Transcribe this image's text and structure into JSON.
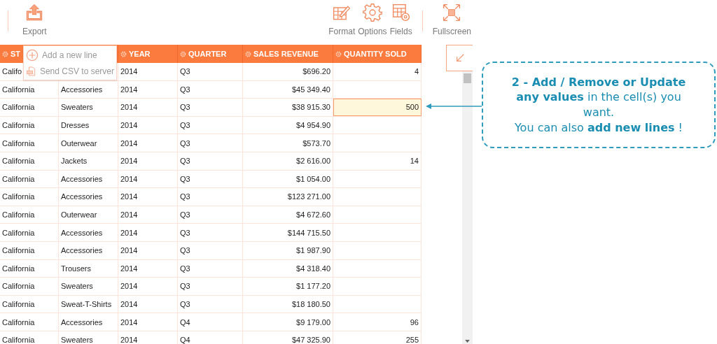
{
  "toolbar": {
    "left": [
      {
        "label": "Export"
      }
    ],
    "right": [
      {
        "label": "Format"
      },
      {
        "label": "Options"
      },
      {
        "label": "Fields"
      }
    ],
    "fullscreen": {
      "label": "Fullscreen"
    }
  },
  "export_menu": [
    {
      "label": "Add a new line"
    },
    {
      "label": "Send CSV to server"
    }
  ],
  "table": {
    "columns": [
      "ST",
      "YEAR",
      "QUARTER",
      "SALES REVENUE",
      "QUANTITY SOLD"
    ],
    "rows": [
      {
        "state": "Califo",
        "product": "",
        "year": "2014",
        "quarter": "Q3",
        "revenue": "$696.20",
        "quantity": "4",
        "editing": false
      },
      {
        "state": "California",
        "product": "Accessories",
        "year": "2014",
        "quarter": "Q3",
        "revenue": "$45 349.40",
        "quantity": "",
        "editing": false
      },
      {
        "state": "California",
        "product": "Sweaters",
        "year": "2014",
        "quarter": "Q3",
        "revenue": "$38 915.30",
        "quantity": "500",
        "editing": true
      },
      {
        "state": "California",
        "product": "Dresses",
        "year": "2014",
        "quarter": "Q3",
        "revenue": "$4 954.90",
        "quantity": "",
        "editing": false
      },
      {
        "state": "California",
        "product": "Outerwear",
        "year": "2014",
        "quarter": "Q3",
        "revenue": "$573.70",
        "quantity": "",
        "editing": false
      },
      {
        "state": "California",
        "product": "Jackets",
        "year": "2014",
        "quarter": "Q3",
        "revenue": "$2 616.00",
        "quantity": "14",
        "editing": false
      },
      {
        "state": "California",
        "product": "Accessories",
        "year": "2014",
        "quarter": "Q3",
        "revenue": "$1 054.00",
        "quantity": "",
        "editing": false
      },
      {
        "state": "California",
        "product": "Accessories",
        "year": "2014",
        "quarter": "Q3",
        "revenue": "$123 271.00",
        "quantity": "",
        "editing": false
      },
      {
        "state": "California",
        "product": "Outerwear",
        "year": "2014",
        "quarter": "Q3",
        "revenue": "$4 672.60",
        "quantity": "",
        "editing": false
      },
      {
        "state": "California",
        "product": "Accessories",
        "year": "2014",
        "quarter": "Q3",
        "revenue": "$144 715.50",
        "quantity": "",
        "editing": false
      },
      {
        "state": "California",
        "product": "Accessories",
        "year": "2014",
        "quarter": "Q3",
        "revenue": "$1 987.90",
        "quantity": "",
        "editing": false
      },
      {
        "state": "California",
        "product": "Trousers",
        "year": "2014",
        "quarter": "Q3",
        "revenue": "$4 318.40",
        "quantity": "",
        "editing": false
      },
      {
        "state": "California",
        "product": "Sweaters",
        "year": "2014",
        "quarter": "Q3",
        "revenue": "$1 177.20",
        "quantity": "",
        "editing": false
      },
      {
        "state": "California",
        "product": "Sweat-T-Shirts",
        "year": "2014",
        "quarter": "Q3",
        "revenue": "$18 180.50",
        "quantity": "",
        "editing": false
      },
      {
        "state": "California",
        "product": "Accessories",
        "year": "2014",
        "quarter": "Q4",
        "revenue": "$9 179.00",
        "quantity": "96",
        "editing": false
      },
      {
        "state": "California",
        "product": "Sweaters",
        "year": "2014",
        "quarter": "Q4",
        "revenue": "$47 325.90",
        "quantity": "255",
        "editing": false
      }
    ]
  },
  "callout": {
    "lines": [
      "**2 - Add / Remove or Update any values** in the cell(s) you want.",
      "You can also **add new lines** !"
    ]
  }
}
